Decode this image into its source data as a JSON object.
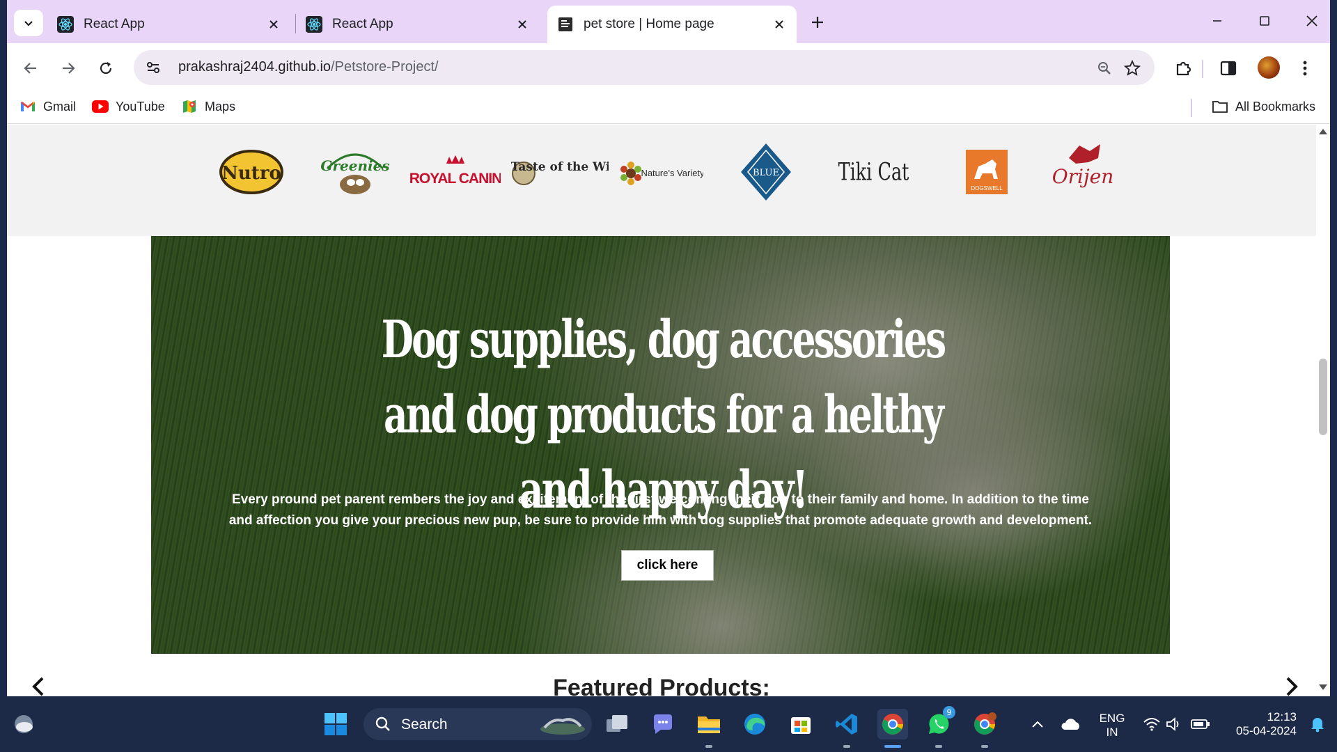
{
  "browser": {
    "tabs": [
      {
        "title": "React App",
        "icon": "react-icon",
        "active": false
      },
      {
        "title": "React App",
        "icon": "react-icon",
        "active": false
      },
      {
        "title": "pet store | Home page",
        "icon": "page-icon",
        "active": true
      }
    ],
    "url_domain": "prakashraj2404.github.io",
    "url_path": "/Petstore-Project/",
    "bookmarks": [
      {
        "label": "Gmail",
        "icon": "gmail-icon"
      },
      {
        "label": "YouTube",
        "icon": "youtube-icon"
      },
      {
        "label": "Maps",
        "icon": "maps-icon"
      }
    ],
    "all_bookmarks_label": "All Bookmarks"
  },
  "page": {
    "brands": [
      "Nutro",
      "Greenies",
      "ROYAL CANIN",
      "Taste of the Wild",
      "Nature's Variety",
      "BLUE",
      "Tiki Cat",
      "DOGSWELL",
      "Orijen"
    ],
    "hero": {
      "title": "Dog supplies, dog accessories and dog products for a helthy and happy day!",
      "text": "Every pround pet parent rembers the joy and excitement of the first welcoming their dog to their family and home. In addition to the time and affection you give your precious new pup, be sure to provide him with dog supplies that promote adequate growth and development.",
      "button_label": "click here"
    },
    "featured_heading": "Featured Products:"
  },
  "taskbar": {
    "search_label": "Search",
    "lang_line1": "ENG",
    "lang_line2": "IN",
    "time": "12:13",
    "date": "05-04-2024",
    "whatsapp_badge": "9"
  },
  "colors": {
    "tabstrip": "#e8d5f7",
    "omnibox": "#efe9f3",
    "brandstrip": "#f2f2f2",
    "taskbar": "#1c2a48"
  }
}
